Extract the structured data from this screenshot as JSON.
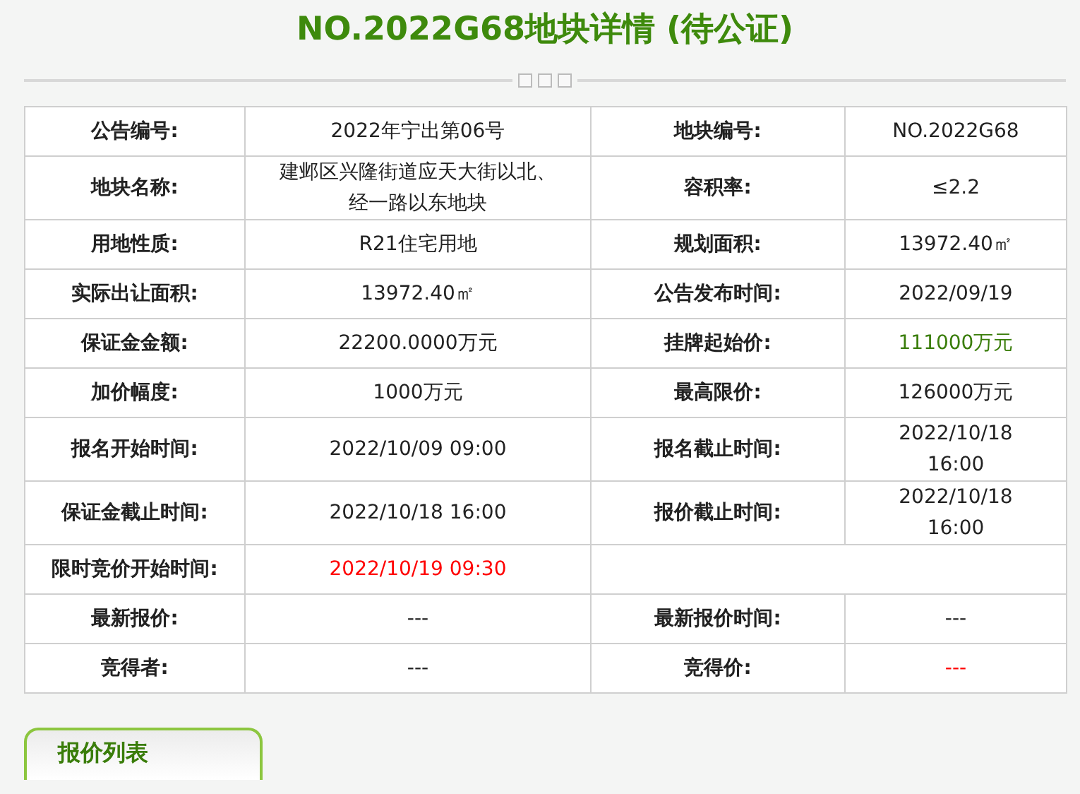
{
  "title": "NO.2022G68地块详情 (待公证)",
  "rows": [
    [
      {
        "label": "公告编号:",
        "value": "2022年宁出第06号"
      },
      {
        "label": "地块编号:",
        "value": "NO.2022G68"
      }
    ],
    [
      {
        "label": "地块名称:",
        "value": "建邺区兴隆街道应天大街以北、经一路以东地块"
      },
      {
        "label": "容积率:",
        "value": "≤2.2"
      }
    ],
    [
      {
        "label": "用地性质:",
        "value": "R21住宅用地"
      },
      {
        "label": "规划面积:",
        "value": "13972.40㎡"
      }
    ],
    [
      {
        "label": "实际出让面积:",
        "value": "13972.40㎡"
      },
      {
        "label": "公告发布时间:",
        "value": "2022/09/19"
      }
    ],
    [
      {
        "label": "保证金金额:",
        "value": "22200.0000万元"
      },
      {
        "label": "挂牌起始价:",
        "value": "111000万元",
        "color": "#3a7d0a"
      }
    ],
    [
      {
        "label": "加价幅度:",
        "value": "1000万元"
      },
      {
        "label": "最高限价:",
        "value": "126000万元"
      }
    ],
    [
      {
        "label": "报名开始时间:",
        "value": "2022/10/09 09:00"
      },
      {
        "label": "报名截止时间:",
        "value": "2022/10/18 16:00"
      }
    ],
    [
      {
        "label": "保证金截止时间:",
        "value": "2022/10/18 16:00"
      },
      {
        "label": "报价截止时间:",
        "value": "2022/10/18 16:00"
      }
    ],
    [
      {
        "label": "限时竞价开始时间:",
        "value": "2022/10/19 09:30",
        "color": "#ff0000"
      }
    ],
    [
      {
        "label": "最新报价:",
        "value": "---"
      },
      {
        "label": "最新报价时间:",
        "value": "---"
      }
    ],
    [
      {
        "label": "竞得者:",
        "value": "---"
      },
      {
        "label": "竞得价:",
        "value": "---",
        "color": "#ff0000"
      }
    ]
  ],
  "section_tab": "报价列表"
}
